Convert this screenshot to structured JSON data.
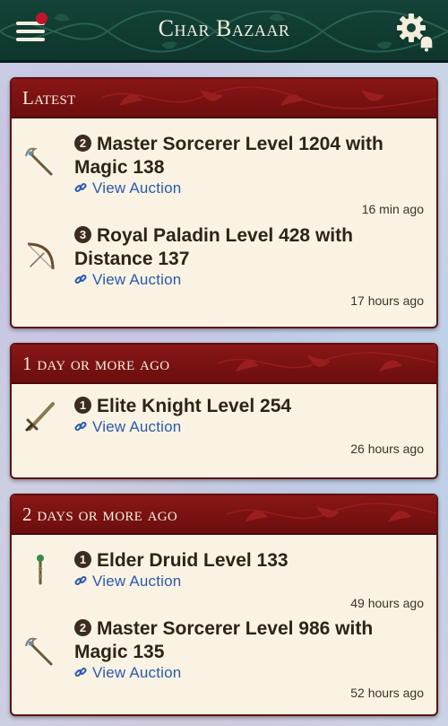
{
  "app": {
    "title": "Char Bazaar",
    "menu_icon": "hamburger-menu-icon",
    "settings_icon": "gear-bell-icon"
  },
  "colors": {
    "header_bg": "#134338",
    "card_head_bg": "#891616",
    "card_bg": "#faf3e3",
    "link": "#2a5ab0",
    "badge": "#c0162a"
  },
  "sections": [
    {
      "title": "Latest",
      "items": [
        {
          "rank": "2",
          "name": "Master Sorcerer Level 1204 with Magic 138",
          "link": "View Auction",
          "time": "16 min ago",
          "icon": "wand-icon"
        },
        {
          "rank": "3",
          "name": "Royal Paladin Level 428 with Distance 137",
          "link": "View Auction",
          "time": "17 hours ago",
          "icon": "bow-icon"
        }
      ]
    },
    {
      "title": "1 day or more ago",
      "items": [
        {
          "rank": "1",
          "name": "Elite Knight Level 254",
          "link": "View Auction",
          "time": "26 hours ago",
          "icon": "sword-icon"
        }
      ]
    },
    {
      "title": "2 days or more ago",
      "items": [
        {
          "rank": "1",
          "name": "Elder Druid Level 133",
          "link": "View Auction",
          "time": "49 hours ago",
          "icon": "rod-icon"
        },
        {
          "rank": "2",
          "name": "Master Sorcerer Level 986 with Magic 135",
          "link": "View Auction",
          "time": "52 hours ago",
          "icon": "wand-icon"
        }
      ]
    }
  ]
}
